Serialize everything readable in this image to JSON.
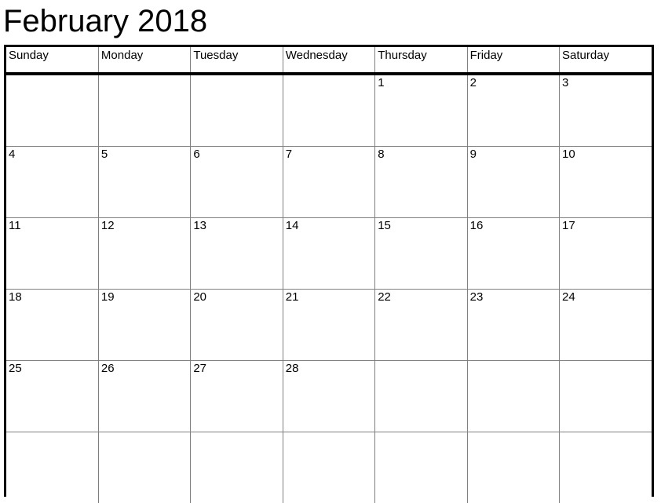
{
  "title": "February 2018",
  "calendar": {
    "month": "February",
    "year": "2018",
    "weekday_headers": [
      "Sunday",
      "Monday",
      "Tuesday",
      "Wednesday",
      "Thursday",
      "Friday",
      "Saturday"
    ],
    "weeks": [
      [
        "",
        "",
        "",
        "",
        "1",
        "2",
        "3"
      ],
      [
        "4",
        "5",
        "6",
        "7",
        "8",
        "9",
        "10"
      ],
      [
        "11",
        "12",
        "13",
        "14",
        "15",
        "16",
        "17"
      ],
      [
        "18",
        "19",
        "20",
        "21",
        "22",
        "23",
        "24"
      ],
      [
        "25",
        "26",
        "27",
        "28",
        "",
        "",
        ""
      ],
      [
        "",
        "",
        "",
        "",
        "",
        "",
        ""
      ]
    ]
  },
  "colors": {
    "page_background": "#ffffff",
    "text": "#000000",
    "outer_border": "#000000",
    "header_rule": "#000000",
    "grid_line": "#808080"
  }
}
